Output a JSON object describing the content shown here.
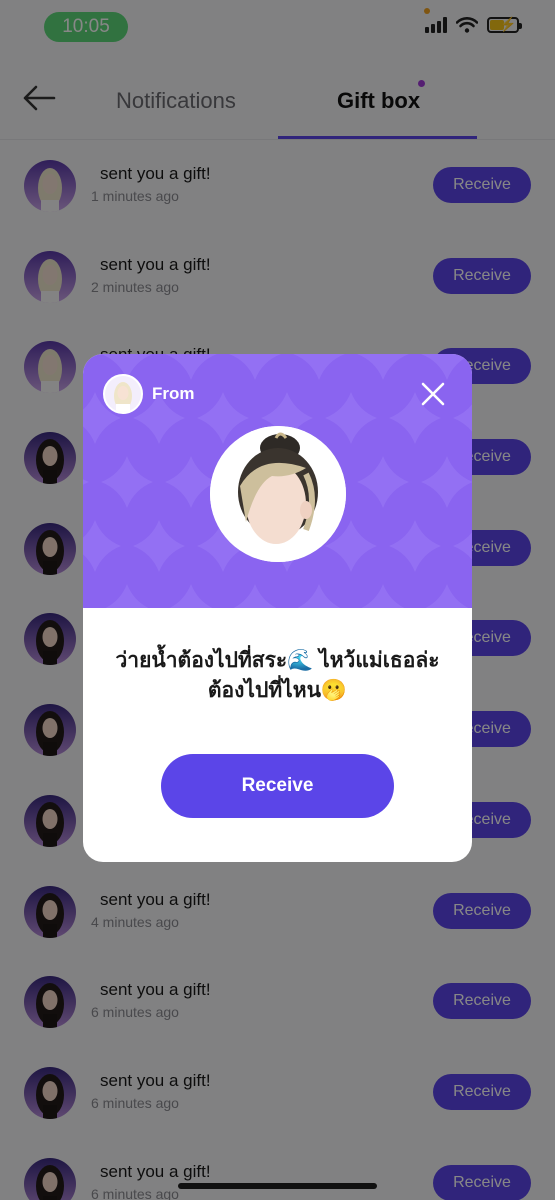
{
  "status_bar": {
    "time": "10:05"
  },
  "header": {
    "tabs": [
      {
        "label": "Notifications",
        "active": false
      },
      {
        "label": "Gift box",
        "active": true
      }
    ]
  },
  "gifts": [
    {
      "title": "sent you a gift!",
      "time": "1 minutes ago",
      "button": "Receive",
      "avatar": "blonde"
    },
    {
      "title": "sent you a gift!",
      "time": "2 minutes ago",
      "button": "Receive",
      "avatar": "blonde"
    },
    {
      "title": "sent you a gift!",
      "time": "",
      "button": "Receive",
      "avatar": "blonde"
    },
    {
      "title": "",
      "time": "",
      "button": "Receive",
      "avatar": "dark"
    },
    {
      "title": "",
      "time": "",
      "button": "Receive",
      "avatar": "dark"
    },
    {
      "title": "",
      "time": "",
      "button": "Receive",
      "avatar": "dark"
    },
    {
      "title": "",
      "time": "",
      "button": "Receive",
      "avatar": "dark"
    },
    {
      "title": "",
      "time": "",
      "button": "Receive",
      "avatar": "dark"
    },
    {
      "title": "sent you a gift!",
      "time": "4 minutes ago",
      "button": "Receive",
      "avatar": "dark"
    },
    {
      "title": "sent you a gift!",
      "time": "6 minutes ago",
      "button": "Receive",
      "avatar": "dark"
    },
    {
      "title": "sent you a gift!",
      "time": "6 minutes ago",
      "button": "Receive",
      "avatar": "dark"
    },
    {
      "title": "sent you a gift!",
      "time": "6 minutes ago",
      "button": "Receive",
      "avatar": "dark"
    }
  ],
  "modal": {
    "from_label": "From",
    "message": "ว่ายน้ำต้องไปที่สระ🌊 ไหว้แม่เธอล่ะต้องไปที่ไหน🫢",
    "receive_label": "Receive"
  },
  "colors": {
    "accent": "#5b45e8",
    "modal_header": "#8a64f0",
    "tab_dot": "#a13ad8",
    "time_pill": "#5dd87a"
  },
  "icons": {
    "back": "back-arrow-icon",
    "close": "close-icon",
    "wifi": "wifi-icon",
    "signal": "signal-icon",
    "battery": "battery-icon"
  }
}
